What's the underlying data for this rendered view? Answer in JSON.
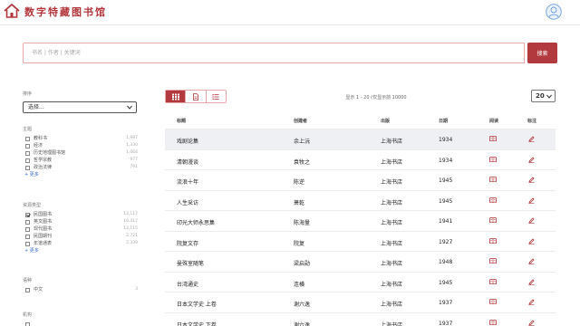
{
  "header": {
    "site_title": "数字特藏图书馆",
    "logo_color": "#b2363b"
  },
  "search": {
    "placeholder": "书名 | 作者 | 关键词",
    "button_label": "搜索"
  },
  "sidebar": {
    "sort_heading": "排序",
    "sort_selected": "选择...",
    "facets": [
      {
        "heading": "主题",
        "items": [
          {
            "label": "教科书",
            "count": "1,997",
            "checked": false
          },
          {
            "label": "经济",
            "count": "1,330",
            "checked": false
          },
          {
            "label": "历史地理图书馆",
            "count": "1,064",
            "checked": false
          },
          {
            "label": "哲学宗教",
            "count": "977",
            "checked": false
          },
          {
            "label": "政治法律",
            "count": "791",
            "checked": false
          }
        ],
        "more": "+ 更多"
      },
      {
        "heading": "资源类型",
        "items": [
          {
            "label": "民国图书",
            "count": "12,117",
            "checked": true
          },
          {
            "label": "英文图书",
            "count": "16,417",
            "checked": false
          },
          {
            "label": "现代图书",
            "count": "12,115",
            "checked": false
          },
          {
            "label": "民国期刊",
            "count": "2,721",
            "checked": false
          },
          {
            "label": "年谱通表",
            "count": "2,339",
            "checked": false
          }
        ],
        "more": "+ 更多"
      },
      {
        "heading": "语种",
        "items": [
          {
            "label": "中文",
            "count": "3",
            "checked": false
          }
        ],
        "more": ""
      },
      {
        "heading": "机构",
        "items": [
          {
            "label": "",
            "count": "",
            "checked": false
          }
        ],
        "more": ""
      }
    ]
  },
  "results": {
    "info": "显示 1 - 20 (仅显示前 10000",
    "per_page": "20",
    "columns": {
      "title": "标题",
      "author": "创建者",
      "publisher": "出版",
      "year": "日期",
      "read": "阅读",
      "mark": "标注"
    },
    "rows": [
      {
        "title": "戏剧论集",
        "author": "余上沅",
        "publisher": "上海书店",
        "year": "1934"
      },
      {
        "title": "清朝漫谈",
        "author": "袁牧之",
        "publisher": "上海书店",
        "year": "1934"
      },
      {
        "title": "流浪十年",
        "author": "陈逆",
        "publisher": "上海书店",
        "year": "1945"
      },
      {
        "title": "人生采访",
        "author": "萧乾",
        "publisher": "上海书店",
        "year": "1945"
      },
      {
        "title": "印光大师永思集",
        "author": "陈海量",
        "publisher": "上海书店",
        "year": "1941"
      },
      {
        "title": "院复文存",
        "author": "院复",
        "publisher": "上海书店",
        "year": "1927"
      },
      {
        "title": "曼殊室随笔",
        "author": "梁启勋",
        "publisher": "上海书店",
        "year": "1948"
      },
      {
        "title": "台湾通史",
        "author": "连横",
        "publisher": "上海书店",
        "year": "1945"
      },
      {
        "title": "日本文学史 上卷",
        "author": "谢六逸",
        "publisher": "上海书店",
        "year": "1937"
      },
      {
        "title": "日本文学史 下卷",
        "author": "谢六逸",
        "publisher": "上海书店",
        "year": "1937"
      }
    ]
  },
  "colors": {
    "accent": "#b23a3e",
    "highlight_row": "#eef0f4",
    "link": "#3b6dc7"
  }
}
